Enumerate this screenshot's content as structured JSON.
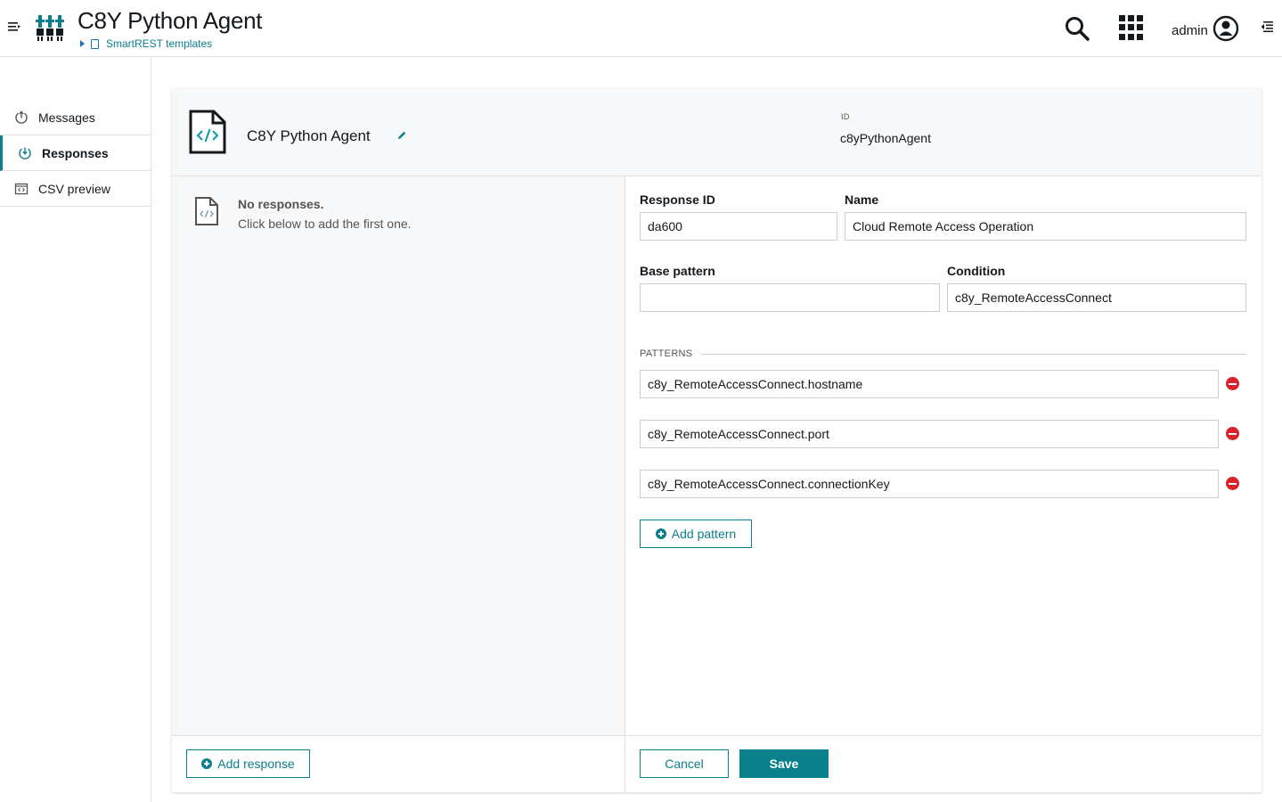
{
  "header": {
    "app_title": "C8Y Python Agent",
    "breadcrumb": "SmartREST templates",
    "user": "admin"
  },
  "sidebar": {
    "items": [
      {
        "label": "Messages",
        "icon": "upload-arrow-icon",
        "active": false
      },
      {
        "label": "Responses",
        "icon": "download-arrow-icon",
        "active": true
      },
      {
        "label": "CSV preview",
        "icon": "code-window-icon",
        "active": false
      }
    ]
  },
  "template": {
    "name": "C8Y Python Agent",
    "id_label": "ID",
    "id_value": "c8yPythonAgent"
  },
  "responses": {
    "empty_title": "No responses.",
    "empty_sub": "Click below to add the first one.",
    "add_label": "Add response"
  },
  "form": {
    "response_id_label": "Response ID",
    "response_id_value": "da600",
    "name_label": "Name",
    "name_value": "Cloud Remote Access Operation",
    "base_pattern_label": "Base pattern",
    "base_pattern_value": "",
    "condition_label": "Condition",
    "condition_value": "c8y_RemoteAccessConnect",
    "patterns_legend": "PATTERNS",
    "patterns": [
      "c8y_RemoteAccessConnect.hostname",
      "c8y_RemoteAccessConnect.port",
      "c8y_RemoteAccessConnect.connectionKey"
    ],
    "add_pattern_label": "Add pattern",
    "cancel_label": "Cancel",
    "save_label": "Save"
  },
  "colors": {
    "accent": "#0b7f8c",
    "danger": "#d9232d",
    "pane_bg": "#f7f8f9"
  }
}
